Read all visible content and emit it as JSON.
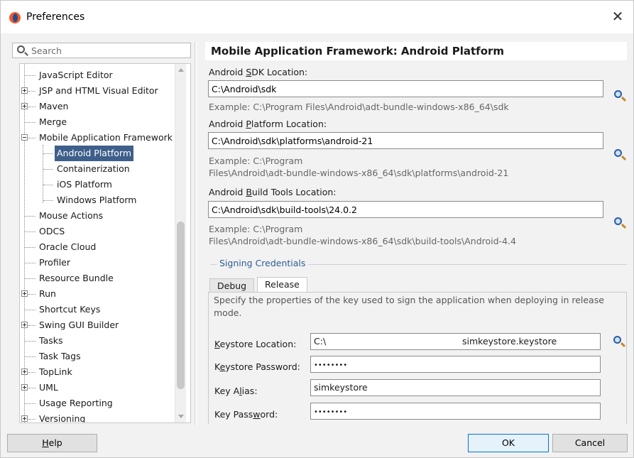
{
  "window": {
    "title": "Preferences",
    "close_glyph": "✕"
  },
  "search": {
    "placeholder": "Search"
  },
  "tree": {
    "items": [
      {
        "label": "JavaScript Editor"
      },
      {
        "label": "JSP and HTML Visual Editor"
      },
      {
        "label": "Maven"
      },
      {
        "label": "Merge"
      },
      {
        "label": "Mobile Application Framework"
      },
      {
        "label": "Android Platform"
      },
      {
        "label": "Containerization"
      },
      {
        "label": "iOS Platform"
      },
      {
        "label": "Windows Platform"
      },
      {
        "label": "Mouse Actions"
      },
      {
        "label": "ODCS"
      },
      {
        "label": "Oracle Cloud"
      },
      {
        "label": "Profiler"
      },
      {
        "label": "Resource Bundle"
      },
      {
        "label": "Run"
      },
      {
        "label": "Shortcut Keys"
      },
      {
        "label": "Swing GUI Builder"
      },
      {
        "label": "Tasks"
      },
      {
        "label": "Task Tags"
      },
      {
        "label": "TopLink"
      },
      {
        "label": "UML"
      },
      {
        "label": "Usage Reporting"
      },
      {
        "label": "Versioning"
      }
    ]
  },
  "panel": {
    "title": "Mobile Application Framework: Android Platform",
    "sdk": {
      "label_pre": "Android ",
      "label_key": "S",
      "label_post": "DK Location:",
      "value": "C:\\Android\\sdk",
      "hint": "Example: C:\\Program Files\\Android\\adt-bundle-windows-x86_64\\sdk"
    },
    "platform": {
      "label_pre": "Android ",
      "label_key": "P",
      "label_post": "latform Location:",
      "value": "C:\\Android\\sdk\\platforms\\android-21",
      "hint_line1": "Example: C:\\Program",
      "hint_line2": "Files\\Android\\adt-bundle-windows-x86_64\\sdk\\platforms\\android-21"
    },
    "build_tools": {
      "label_pre": "Android ",
      "label_key": "B",
      "label_post": "uild Tools Location:",
      "value": "C:\\Android\\sdk\\build-tools\\24.0.2",
      "hint_line1": "Example: C:\\Program",
      "hint_line2": "Files\\Android\\adt-bundle-windows-x86_64\\sdk\\build-tools\\Android-4.4"
    },
    "signing": {
      "group_label": "Signing Credentials",
      "tabs": [
        "Debug",
        "Release"
      ],
      "description": "Specify the properties of the key used to sign the application when deploying in release mode.",
      "keystore_location": {
        "label_pre": "",
        "label_key": "K",
        "label_post": "eystore Location:",
        "value_prefix": "C:\\",
        "value_suffix": "simkeystore.keystore"
      },
      "keystore_password": {
        "label_pre": "K",
        "label_key": "e",
        "label_post": "ystore Password:",
        "value": "••••••••"
      },
      "key_alias": {
        "label_pre": "Key A",
        "label_key": "l",
        "label_post": "ias:",
        "value": "simkeystore"
      },
      "key_password": {
        "label_pre": "Key Pass",
        "label_key": "w",
        "label_post": "ord:",
        "value": "••••••••"
      }
    }
  },
  "footer": {
    "help_pre": "",
    "help_key": "H",
    "help_post": "elp",
    "ok": "OK",
    "cancel": "Cancel"
  }
}
